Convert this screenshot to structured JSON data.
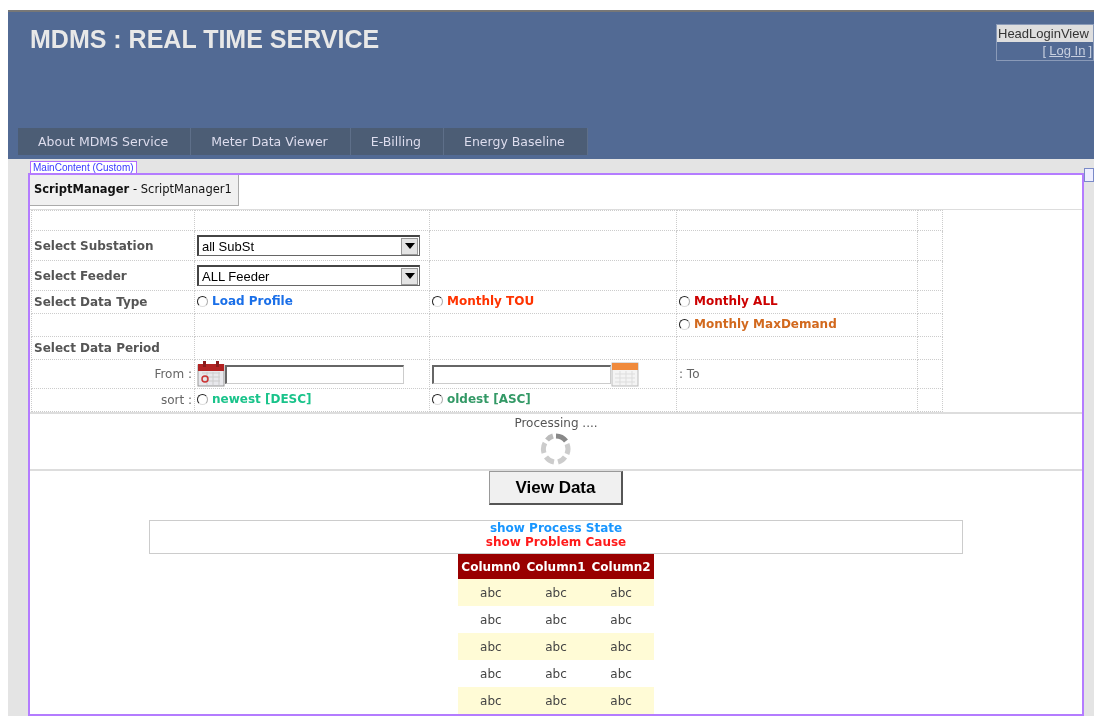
{
  "header": {
    "title": "MDMS : REAL TIME SERVICE",
    "login_view": {
      "label": "HeadLoginView",
      "link_open": "[",
      "link": "Log In",
      "link_close": "]"
    }
  },
  "nav": [
    {
      "label": "About MDMS Service"
    },
    {
      "label": "Meter Data Viewer"
    },
    {
      "label": "E-Billing"
    },
    {
      "label": "Energy Baseline"
    }
  ],
  "main_content_label": "MainContent (Custom)",
  "script_manager": "**ScriptManager** - ScriptManager1",
  "form": {
    "substation": {
      "label": "Select Substation",
      "value": "all SubSt"
    },
    "feeder": {
      "label": "Select Feeder",
      "value": "ALL Feeder"
    },
    "data_type": {
      "label": "Select Data Type",
      "options": [
        {
          "label": "Load Profile",
          "color": "#1a6fe8",
          "selected": false
        },
        {
          "label": "Monthly TOU",
          "color": "#ff3300",
          "selected": false
        },
        {
          "label": "Monthly ALL",
          "color": "#cc0000",
          "selected": false
        },
        {
          "label": "Monthly MaxDemand",
          "color": "#d2691e",
          "selected": false
        }
      ]
    },
    "period": {
      "label": "Select Data Period",
      "from_label": "From :",
      "to_label": ": To"
    },
    "sort": {
      "label": "sort :",
      "options": [
        {
          "label": "newest [DESC]",
          "color": "#19c38a",
          "selected": false
        },
        {
          "label": "oldest [ASC]",
          "color": "#339966",
          "selected": false
        }
      ]
    }
  },
  "processing": "Processing ....",
  "view_button": "View Data",
  "status": {
    "process_state": "show Process State",
    "problem_cause": "show Problem Cause"
  },
  "table": {
    "columns": [
      "Column0",
      "Column1",
      "Column2"
    ],
    "rows": [
      [
        "abc",
        "abc",
        "abc"
      ],
      [
        "abc",
        "abc",
        "abc"
      ],
      [
        "abc",
        "abc",
        "abc"
      ],
      [
        "abc",
        "abc",
        "abc"
      ],
      [
        "abc",
        "abc",
        "abc"
      ]
    ]
  }
}
